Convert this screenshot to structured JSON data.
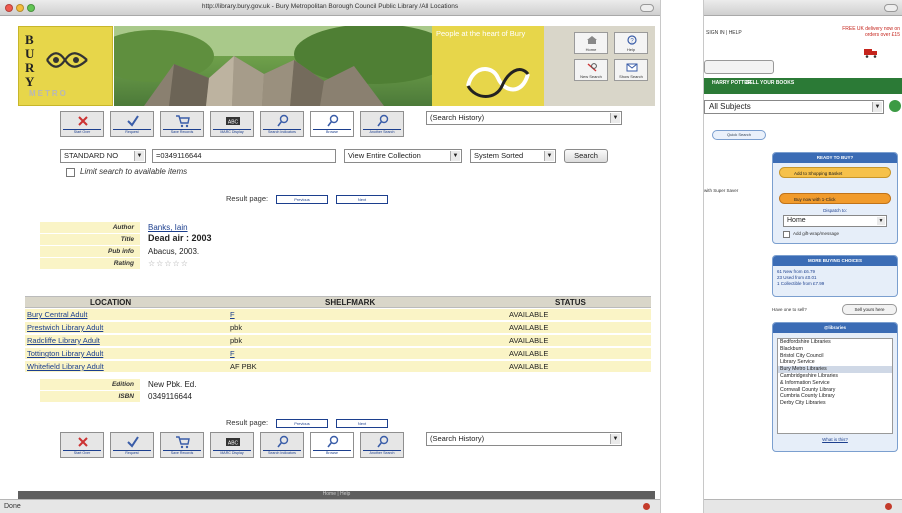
{
  "window": {
    "title": "http://library.bury.gov.uk - Bury Metropolitan Borough Council Public Library /All Locations",
    "status": "Done"
  },
  "header": {
    "logo_word": [
      "B",
      "U",
      "R",
      "Y"
    ],
    "logo_sub": "METRO",
    "slogan": "People at the heart of Bury",
    "nav_buttons": [
      "Home",
      "Help",
      "New Search",
      "Show Search"
    ]
  },
  "toolbar": {
    "buttons": [
      "Start Over",
      "Request",
      "Save Records",
      "MARC Display",
      "Search Indicators",
      "Browse",
      "Another Search"
    ],
    "history_select": "(Search History)"
  },
  "search": {
    "field_select": "STANDARD NO",
    "query": "=0349116644",
    "scope_select": "View Entire Collection",
    "sort_select": "System Sorted",
    "search_button": "Search",
    "limit_label": "Limit search to available items"
  },
  "result_page": {
    "label": "Result page:",
    "prev": "Previous",
    "next": "Next"
  },
  "record": {
    "author_label": "Author",
    "author": "Banks, Iain",
    "title_label": "Title",
    "title": "Dead air : 2003",
    "pubinfo_label": "Pub info",
    "pubinfo": "Abacus, 2003.",
    "rating_label": "Rating",
    "rating_stars": "☆☆☆☆☆",
    "edition_label": "Edition",
    "edition": "New Pbk. Ed.",
    "isbn_label": "ISBN",
    "isbn": "0349116644"
  },
  "holdings": {
    "headers": [
      "LOCATION",
      "SHELFMARK",
      "STATUS"
    ],
    "rows": [
      {
        "location": "Bury Central Adult",
        "shelfmark": "F",
        "status": "AVAILABLE"
      },
      {
        "location": "Prestwich Library Adult",
        "shelfmark": "pbk",
        "status": "AVAILABLE"
      },
      {
        "location": "Radcliffe Library Adult",
        "shelfmark": "pbk",
        "status": "AVAILABLE"
      },
      {
        "location": "Tottington Library Adult",
        "shelfmark": "F",
        "status": "AVAILABLE"
      },
      {
        "location": "Whitefield Library Adult",
        "shelfmark": "AF PBK",
        "status": "AVAILABLE"
      }
    ]
  },
  "footer": "Home | Help",
  "right_window": {
    "top_links": "SIGN IN | HELP",
    "free_delivery": "FREE UK delivery now on orders over £15",
    "green_tabs": [
      "HARRY POTTER",
      "SELL YOUR BOOKS"
    ],
    "subject_select": "All Subjects",
    "quick_pill": "Quick Search",
    "side_text": "with Super Saver",
    "ready_to_buy": "READY TO BUY?",
    "add_basket": "Add to Shopping Basket",
    "buy_now": "Buy now with 1-Click",
    "dispatch_label": "Dispatch to:",
    "dispatch_value": "Home",
    "gift_wrap": "Add gift-wrap/message",
    "more_buying": "MORE BUYING CHOICES",
    "choices": [
      "61 New from £6.79",
      "23 Used from £0.01",
      "1 Collectible from £7.99"
    ],
    "sell_prompt": "Have one to sell?",
    "sell_button": "Sell yours here",
    "libraries_head": "@libraries",
    "libraries": [
      "Bedfordshire Libraries",
      "Blackburn",
      "Bristol City Council",
      "Library Service",
      "Bury Metro Libraries",
      "Cambridgeshire Libraries",
      "& Information Service",
      "Cornwall County Library",
      "Cumbria County Library",
      "Derby City Libraries"
    ],
    "libraries_selected": "Bury Metro Libraries",
    "what_link": "What is this?"
  },
  "colors": {
    "bury_yellow": "#e7d64a",
    "row_yellow": "#faf4c6",
    "link_blue": "#1c3f8e",
    "amazon_green": "#2b7a36",
    "amazon_blue": "#3b6cb5"
  }
}
